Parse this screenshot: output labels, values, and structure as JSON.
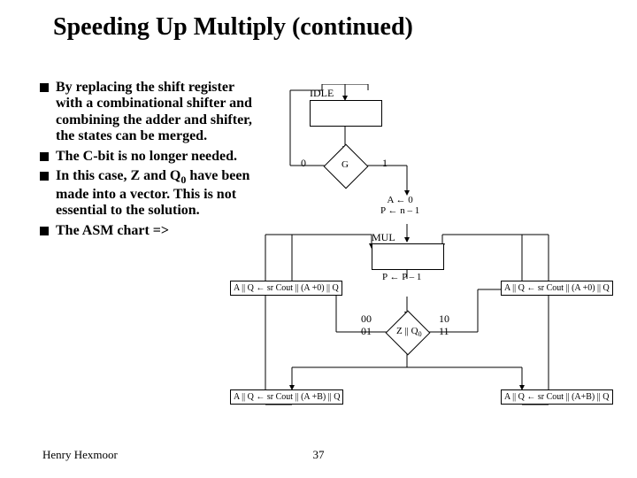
{
  "title": "Speeding Up Multiply (continued)",
  "bullets": {
    "b1": "By replacing the shift register with a combinational shifter and combining the adder and shifter, the states can be merged.",
    "b2": "The C-bit is no longer needed.",
    "b3_a": "In this case, Z and Q",
    "b3_sub": "0",
    "b3_b": " have been made into a vector. This is not essential to the solution.",
    "b4": "The ASM chart =>"
  },
  "diagram": {
    "idle": "IDLE",
    "zero": "0",
    "one": "1",
    "g": "G",
    "init": "A ← 0\nP ← n – 1",
    "mul": "MUL",
    "pdec": "P ← P – 1",
    "op0": "A || Q ← sr Cout || (A +0) || Q",
    "op0r": "A || Q ← sr Cout || (A +0) || Q",
    "opB": "A || Q ← sr Cout || (A +B) || Q",
    "opBr": "A || Q ← sr Cout || (A+B) || Q",
    "zq": "Z || Q",
    "zq_sub": "0",
    "d00": "00",
    "d01": "01",
    "d10": "10",
    "d11": "11"
  },
  "footer": {
    "author": "Henry Hexmoor",
    "page": "37"
  }
}
